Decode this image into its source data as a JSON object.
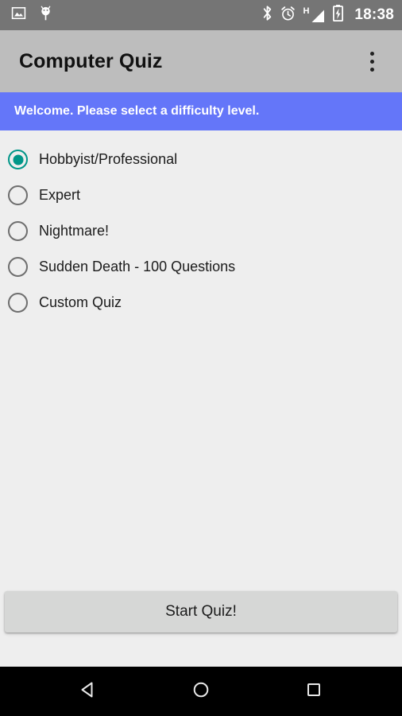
{
  "status_bar": {
    "icons_left": [
      "image-icon",
      "android-debug-icon"
    ],
    "icons_right": [
      "bluetooth-icon",
      "alarm-icon",
      "signal-h-icon",
      "battery-charging-icon"
    ],
    "network_type": "H",
    "time": "18:38",
    "background_color": "#757575"
  },
  "app_bar": {
    "title": "Computer Quiz",
    "overflow_icon": "more-vert-icon",
    "background_color": "#BDBDBD"
  },
  "banner": {
    "message": "Welcome. Please select a difficulty level.",
    "background_color": "#6476F9",
    "text_color": "#FFFFFF"
  },
  "difficulty": {
    "selected_index": 0,
    "accent_color": "#009688",
    "options": [
      {
        "label": "Hobbyist/Professional",
        "selected": true
      },
      {
        "label": "Expert",
        "selected": false
      },
      {
        "label": "Nightmare!",
        "selected": false
      },
      {
        "label": "Sudden Death - 100 Questions",
        "selected": false
      },
      {
        "label": "Custom Quiz",
        "selected": false
      }
    ]
  },
  "actions": {
    "start_label": "Start Quiz!",
    "start_background_color": "#D6D7D6"
  },
  "nav_bar": {
    "background_color": "#000000",
    "buttons": [
      {
        "name": "back",
        "icon": "back-triangle-icon"
      },
      {
        "name": "home",
        "icon": "home-circle-icon"
      },
      {
        "name": "recents",
        "icon": "recents-square-icon"
      }
    ]
  }
}
